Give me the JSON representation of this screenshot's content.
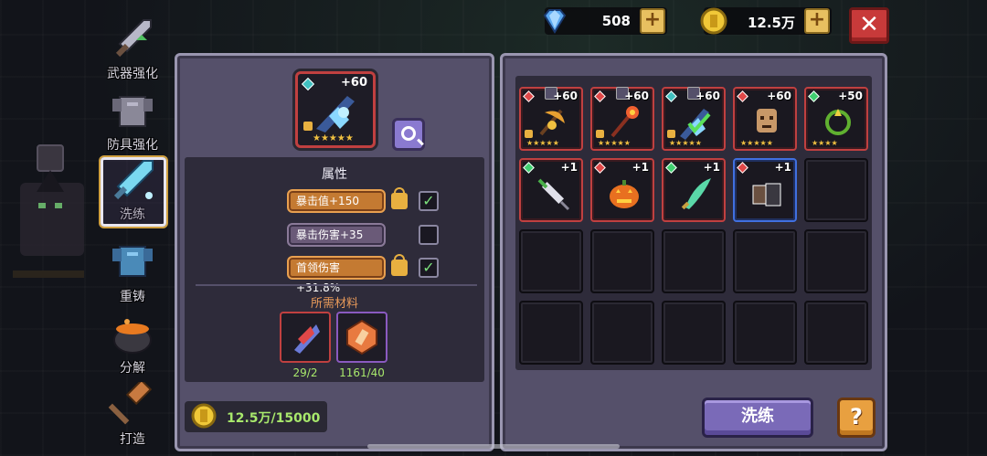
{
  "currency": {
    "gems": "508",
    "gold": "12.5万",
    "gem_color": "#5aa8f0",
    "gold_color": "#f0c838"
  },
  "nav": [
    {
      "label": "武器强化",
      "icon": "sword-icon"
    },
    {
      "label": "防具强化",
      "icon": "armor-icon"
    },
    {
      "label": "洗练",
      "icon": "crystal-sword-icon"
    },
    {
      "label": "重铸",
      "icon": "reforge-armor-icon"
    },
    {
      "label": "分解",
      "icon": "cauldron-icon"
    },
    {
      "label": "打造",
      "icon": "hammer-icon"
    }
  ],
  "selected_item": {
    "level": "+60",
    "stars": "★★★★★"
  },
  "attributes": {
    "title": "属性",
    "rows": [
      {
        "text": "暴击值+150",
        "locked": true,
        "checked": true
      },
      {
        "text": "暴击伤害+35",
        "locked": false,
        "checked": false
      },
      {
        "text": "首领伤害+31.8%",
        "locked": true,
        "checked": true
      }
    ]
  },
  "materials": {
    "title": "所需材料",
    "items": [
      {
        "count": "29/2",
        "border": "#c04040"
      },
      {
        "count": "1161/40",
        "border": "#8a5ac0"
      }
    ]
  },
  "cost": {
    "text": "12.5万/15000"
  },
  "inventory": [
    {
      "level": "+60",
      "stars": "★★★★★",
      "gem": "red",
      "border": "red",
      "locked": true,
      "tag": true,
      "art": "scythe"
    },
    {
      "level": "+60",
      "stars": "★★★★★",
      "gem": "red",
      "border": "red",
      "locked": true,
      "tag": true,
      "art": "staff"
    },
    {
      "level": "+60",
      "stars": "★★★★★",
      "gem": "teal",
      "border": "red",
      "locked": true,
      "tag": true,
      "art": "crystal"
    },
    {
      "level": "+60",
      "stars": "★★★★★",
      "gem": "red",
      "border": "red",
      "locked": false,
      "tag": false,
      "art": "mask"
    },
    {
      "level": "+50",
      "stars": "★★★★",
      "gem": "green",
      "border": "red",
      "locked": false,
      "tag": false,
      "art": "ring"
    },
    {
      "level": "+1",
      "stars": "",
      "gem": "green",
      "border": "red",
      "locked": false,
      "tag": false,
      "art": "syringe"
    },
    {
      "level": "+1",
      "stars": "",
      "gem": "red",
      "border": "red",
      "locked": false,
      "tag": false,
      "art": "pumpkin"
    },
    {
      "level": "+1",
      "stars": "",
      "gem": "green",
      "border": "red",
      "locked": false,
      "tag": false,
      "art": "blade"
    },
    {
      "level": "+1",
      "stars": "",
      "gem": "red",
      "border": "blue",
      "locked": false,
      "tag": false,
      "art": "gauntlet"
    }
  ],
  "buttons": {
    "wash": "洗练",
    "help": "?",
    "close": "✕",
    "plus": "+"
  }
}
